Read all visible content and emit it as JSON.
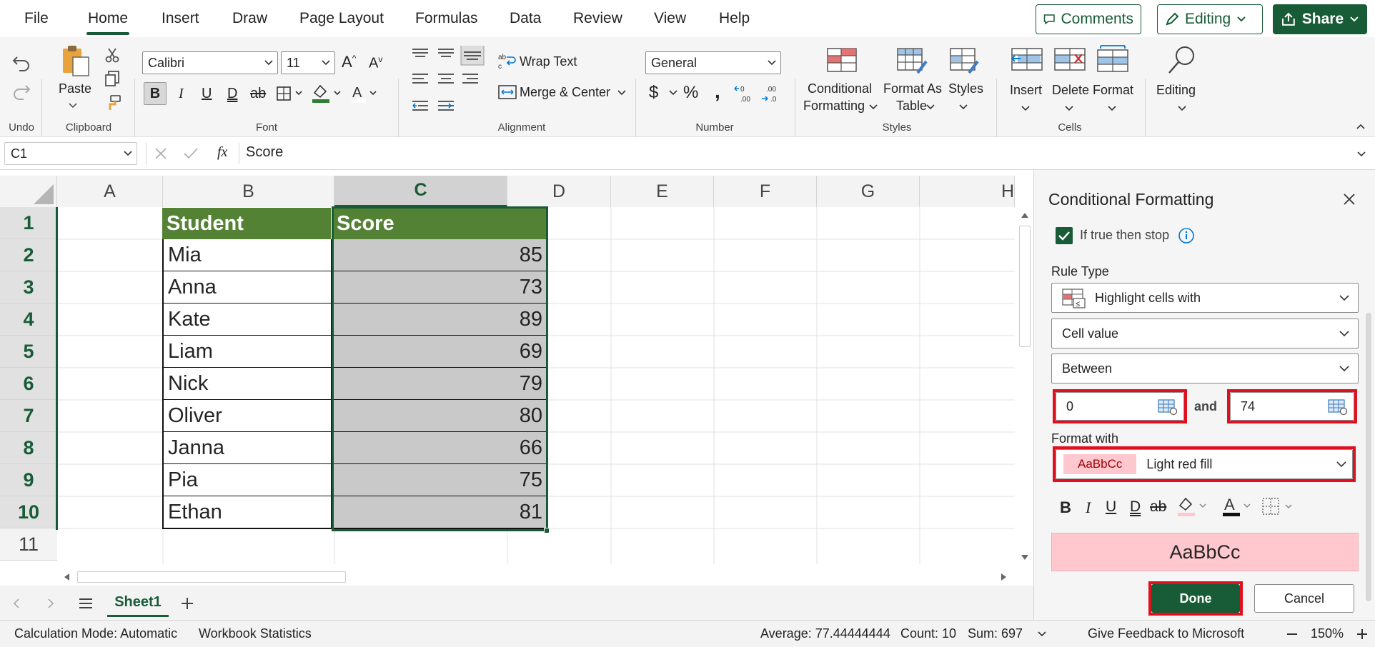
{
  "menu": {
    "tabs": [
      "File",
      "Home",
      "Insert",
      "Draw",
      "Page Layout",
      "Formulas",
      "Data",
      "Review",
      "View",
      "Help"
    ],
    "active_tab": "Home",
    "comments_label": "Comments",
    "editing_label": "Editing",
    "share_label": "Share"
  },
  "ribbon": {
    "undo_group": "Undo",
    "paste_label": "Paste",
    "clipboard_group": "Clipboard",
    "font_name": "Calibri",
    "font_size": "11",
    "font_group": "Font",
    "wrap_text": "Wrap Text",
    "merge_center": "Merge & Center",
    "alignment_group": "Alignment",
    "number_format": "General",
    "number_group": "Number",
    "conditional_formatting_1": "Conditional",
    "conditional_formatting_2": "Formatting",
    "format_as_table_1": "Format As",
    "format_as_table_2": "Table",
    "styles_label": "Styles",
    "styles_group": "Styles",
    "insert_label": "Insert",
    "delete_label": "Delete",
    "format_label": "Format",
    "cells_group": "Cells",
    "editing_label": "Editing"
  },
  "formula_bar": {
    "name_box": "C1",
    "fx": "fx",
    "content": "Score"
  },
  "grid": {
    "columns": [
      "A",
      "B",
      "C",
      "D",
      "E",
      "F",
      "G",
      "H"
    ],
    "rows": [
      "1",
      "2",
      "3",
      "4",
      "5",
      "6",
      "7",
      "8",
      "9",
      "10",
      "11"
    ],
    "header_student": "Student",
    "header_score": "Score",
    "students": [
      "Mia",
      "Anna",
      "Kate",
      "Liam",
      "Nick",
      "Oliver",
      "Janna",
      "Pia",
      "Ethan"
    ],
    "scores": [
      "85",
      "73",
      "89",
      "69",
      "79",
      "80",
      "66",
      "75",
      "81"
    ]
  },
  "sheet_tabs": {
    "active": "Sheet1"
  },
  "panel": {
    "title": "Conditional Formatting",
    "stop_label": "If true then stop",
    "rule_type_label": "Rule Type",
    "rule_type_value": "Highlight cells with",
    "condition_value": "Cell value",
    "operator_value": "Between",
    "min_value": "0",
    "and_label": "and",
    "max_value": "74",
    "format_with_label": "Format with",
    "format_sample": "AaBbCc",
    "format_value": "Light red fill",
    "preview_text": "AaBbCc",
    "done_label": "Done",
    "cancel_label": "Cancel"
  },
  "status": {
    "calc_mode": "Calculation Mode: Automatic",
    "workbook_stats": "Workbook Statistics",
    "average": "Average: 77.44444444",
    "count": "Count: 10",
    "sum": "Sum: 697",
    "feedback": "Give Feedback to Microsoft",
    "zoom": "150%"
  },
  "colors": {
    "accent": "#185c37",
    "header_fill": "#548235",
    "selection_fill": "#c9c9c9",
    "light_red_fill": "#ffc7ce",
    "highlight_red": "#e0101f"
  }
}
